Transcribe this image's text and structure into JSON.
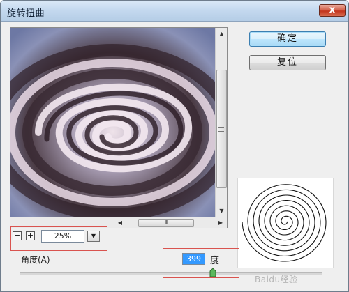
{
  "window": {
    "title": "旋转扭曲",
    "close_glyph": "x"
  },
  "buttons": {
    "ok": "确定",
    "reset": "复位"
  },
  "zoom": {
    "minus": "−",
    "plus": "+",
    "value": "25%"
  },
  "angle": {
    "label": "角度(A)",
    "value": "399",
    "unit": "度",
    "slider_fraction": 0.638
  },
  "scroll": {
    "up_arrow": "▲",
    "down_arrow": "▼",
    "left_arrow": "◀",
    "right_arrow": "▶",
    "thumb_grip": "III"
  },
  "watermark": "Baidu经验",
  "colors": {
    "highlight": "#d9534f",
    "selection": "#3399ff"
  }
}
